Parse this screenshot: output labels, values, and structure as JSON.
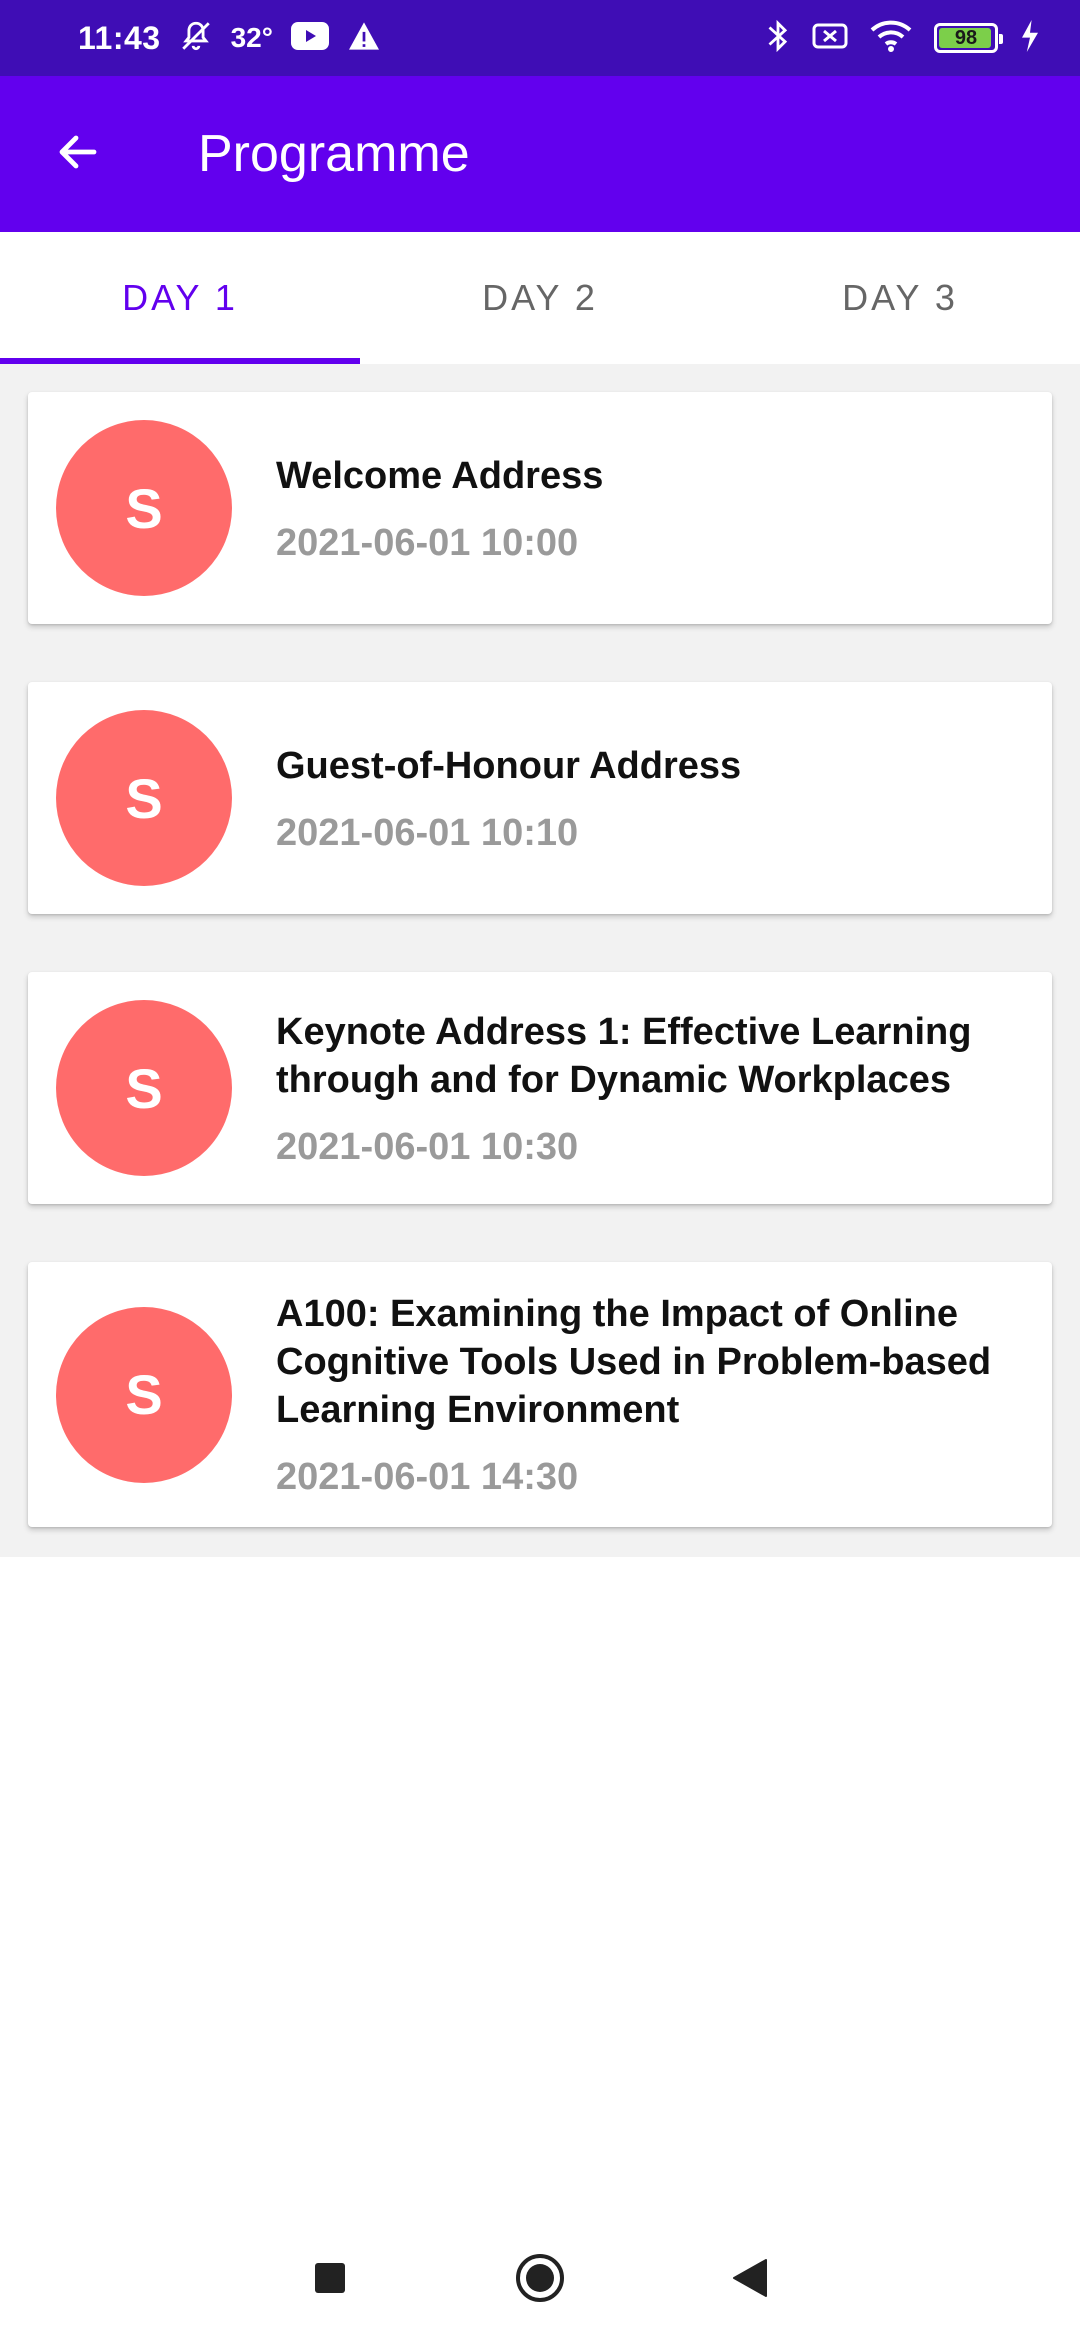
{
  "status_bar": {
    "time": "11:43",
    "temperature": "32°",
    "battery": "98"
  },
  "app_bar": {
    "title": "Programme"
  },
  "tabs": [
    {
      "label": "DAY 1",
      "active": true
    },
    {
      "label": "DAY 2",
      "active": false
    },
    {
      "label": "DAY 3",
      "active": false
    }
  ],
  "sessions": [
    {
      "avatar": "S",
      "title": "Welcome Address",
      "datetime": "2021-06-01 10:00"
    },
    {
      "avatar": "S",
      "title": "Guest-of-Honour Address",
      "datetime": "2021-06-01 10:10"
    },
    {
      "avatar": "S",
      "title": "Keynote Address 1: Effective Learning through and for Dynamic Workplaces",
      "datetime": "2021-06-01 10:30"
    },
    {
      "avatar": "S",
      "title": "A100: Examining the Impact of Online Cognitive Tools Used in Problem-based Learning Environment",
      "datetime": "2021-06-01 14:30"
    }
  ],
  "colors": {
    "status_bar": "#3f0db5",
    "app_bar": "#6200ee",
    "accent": "#6200ee",
    "avatar": "#ff6b6b"
  }
}
